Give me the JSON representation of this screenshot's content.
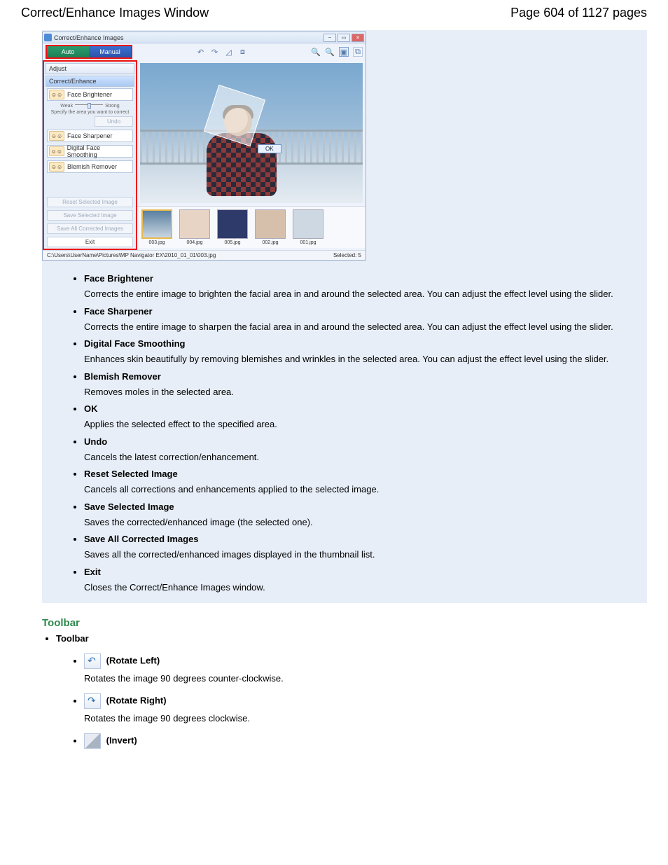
{
  "header": {
    "title": "Correct/Enhance Images Window",
    "page_label": "Page 604 of 1127 pages"
  },
  "app": {
    "window_title": "Correct/Enhance Images",
    "tabs": {
      "auto": "Auto",
      "manual": "Manual"
    },
    "panel": {
      "adjust": "Adjust",
      "correct_enhance": "Correct/Enhance",
      "face_brightener": "Face Brightener",
      "slider_weak": "Weak",
      "slider_strong": "Strong",
      "slider_ticks": "1   2   3",
      "specify_area": "Specify the area you want to correct",
      "undo": "Undo",
      "face_sharpener": "Face Sharpener",
      "digital_face_smoothing": "Digital Face Smoothing",
      "blemish_remover": "Blemish Remover",
      "reset_selected": "Reset Selected Image",
      "save_selected": "Save Selected Image",
      "save_all": "Save All Corrected Images",
      "exit": "Exit"
    },
    "canvas": {
      "ok": "OK"
    },
    "thumbs": [
      "003.jpg",
      "004.jpg",
      "005.jpg",
      "002.jpg",
      "001.jpg"
    ],
    "status_path": "C:\\Users\\UserName\\Pictures\\MP Navigator EX\\2010_01_01\\003.jpg",
    "status_selected": "Selected: 5"
  },
  "definitions": [
    {
      "term": "Face Brightener",
      "desc": "Corrects the entire image to brighten the facial area in and around the selected area. You can adjust the effect level using the slider."
    },
    {
      "term": "Face Sharpener",
      "desc": "Corrects the entire image to sharpen the facial area in and around the selected area. You can adjust the effect level using the slider."
    },
    {
      "term": "Digital Face Smoothing",
      "desc": "Enhances skin beautifully by removing blemishes and wrinkles in the selected area. You can adjust the effect level using the slider."
    },
    {
      "term": "Blemish Remover",
      "desc": "Removes moles in the selected area."
    },
    {
      "term": "OK",
      "desc": "Applies the selected effect to the specified area."
    },
    {
      "term": "Undo",
      "desc": "Cancels the latest correction/enhancement."
    },
    {
      "term": "Reset Selected Image",
      "desc": "Cancels all corrections and enhancements applied to the selected image."
    },
    {
      "term": "Save Selected Image",
      "desc": "Saves the corrected/enhanced image (the selected one)."
    },
    {
      "term": "Save All Corrected Images",
      "desc": "Saves all the corrected/enhanced images displayed in the thumbnail list."
    },
    {
      "term": "Exit",
      "desc": "Closes the Correct/Enhance Images window."
    }
  ],
  "toolbar_section": {
    "heading": "Toolbar",
    "label": "Toolbar",
    "items": [
      {
        "label": " (Rotate Left)",
        "desc": "Rotates the image 90 degrees counter-clockwise."
      },
      {
        "label": " (Rotate Right)",
        "desc": "Rotates the image 90 degrees clockwise."
      },
      {
        "label": " (Invert)",
        "desc": ""
      }
    ]
  }
}
